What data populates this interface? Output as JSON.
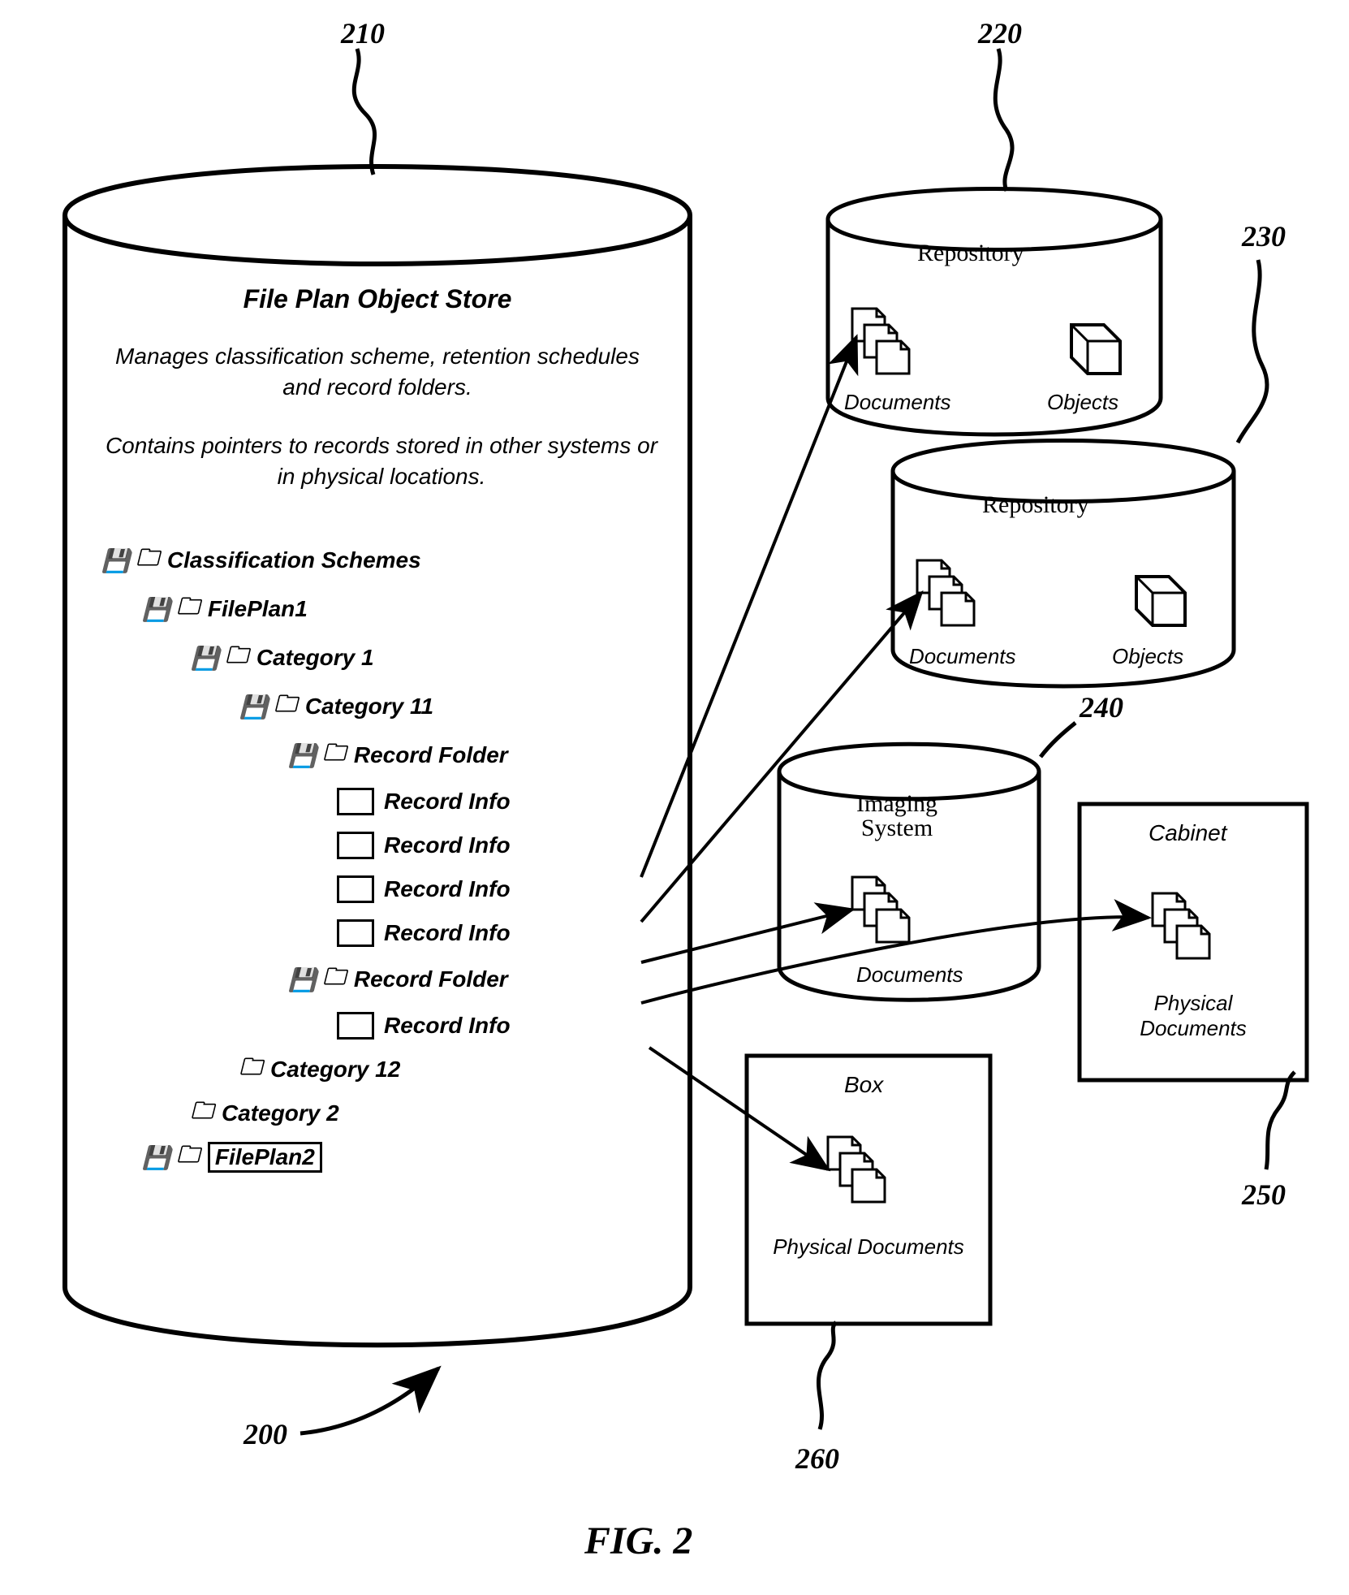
{
  "indices": {
    "fileplan": "210",
    "repo1": "220",
    "repo2": "230",
    "imaging": "240",
    "cabinet": "250",
    "box": "260",
    "overall": "200"
  },
  "figure_caption": "FIG. 2",
  "fileplan": {
    "title": "File Plan Object Store",
    "desc1": "Manages classification scheme, retention schedules and record folders.",
    "desc2": "Contains pointers to records stored in other systems or in physical locations.",
    "tree": {
      "root": "Classification Schemes",
      "fp1": "FilePlan1",
      "cat1": "Category 1",
      "cat11": "Category 11",
      "rf1": "Record Folder",
      "ri": "Record Info",
      "rf2": "Record Folder",
      "cat12": "Category 12",
      "cat2": "Category 2",
      "fp2": "FilePlan2"
    }
  },
  "repo": {
    "title": "Repository",
    "docs": "Documents",
    "objs": "Objects"
  },
  "imaging": {
    "title1": "Imaging",
    "title2": "System",
    "docs": "Documents"
  },
  "cabinet": {
    "title": "Cabinet",
    "docs": "Physical Documents"
  },
  "box": {
    "title": "Box",
    "docs": "Physical Documents"
  }
}
